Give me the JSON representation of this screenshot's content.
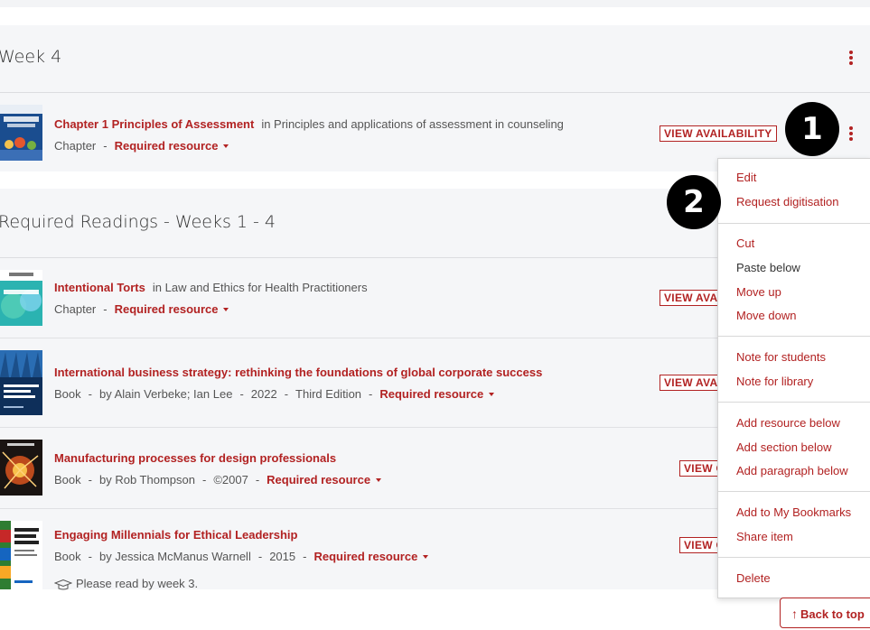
{
  "sections": [
    {
      "title": "Week 4",
      "items": [
        {
          "title": "Chapter 1 Principles of Assessment",
          "in_text": "in Principles and applications of assessment in counseling",
          "type": "Chapter",
          "status": "Required resource",
          "button": "VIEW AVAILABILITY"
        }
      ]
    },
    {
      "title": "Required Readings - Weeks 1 - 4",
      "items": [
        {
          "title": "Intentional Torts",
          "in_text": "in Law and Ethics for Health Practitioners",
          "type": "Chapter",
          "status": "Required resource",
          "button": "VIEW AVA"
        },
        {
          "title": "International business strategy: rethinking the foundations of global corporate success",
          "type": "Book",
          "author": "by Alain Verbeke; Ian Lee",
          "year": "2022",
          "edition": "Third Edition",
          "status": "Required resource",
          "button": "VIEW AVA"
        },
        {
          "title": "Manufacturing processes for design professionals",
          "type": "Book",
          "author": "by Rob Thompson",
          "year": "©2007",
          "status": "Required resource",
          "button": "VIEW C"
        },
        {
          "title": "Engaging Millennials for Ethical Leadership",
          "type": "Book",
          "author": "by Jessica McManus Warnell",
          "year": "2015",
          "status": "Required resource",
          "button": "VIEW C",
          "note": "Please read by week 3."
        }
      ]
    }
  ],
  "separator": "-",
  "menu": {
    "groups": [
      [
        {
          "label": "Edit",
          "tone": "red"
        },
        {
          "label": "Request digitisation",
          "tone": "red"
        }
      ],
      [
        {
          "label": "Cut",
          "tone": "red"
        },
        {
          "label": "Paste below",
          "tone": "dark"
        },
        {
          "label": "Move up",
          "tone": "red"
        },
        {
          "label": "Move down",
          "tone": "red"
        }
      ],
      [
        {
          "label": "Note for students",
          "tone": "red"
        },
        {
          "label": "Note for library",
          "tone": "red"
        }
      ],
      [
        {
          "label": "Add resource below",
          "tone": "red"
        },
        {
          "label": "Add section below",
          "tone": "red"
        },
        {
          "label": "Add paragraph below",
          "tone": "red"
        }
      ],
      [
        {
          "label": "Add to My Bookmarks",
          "tone": "red"
        },
        {
          "label": "Share item",
          "tone": "red"
        }
      ],
      [
        {
          "label": "Delete",
          "tone": "red"
        }
      ]
    ]
  },
  "callouts": [
    "1",
    "2"
  ],
  "back_to_top": "Back to top",
  "icons": {
    "kebab": "vertical-ellipsis-icon",
    "caret": "caret-down-icon",
    "note": "mortarboard-icon",
    "back": "arrow-up-icon"
  },
  "colors": {
    "accent": "#b22222",
    "section_bg": "#f5f6f8",
    "text": "#333333",
    "badge": "#000000"
  }
}
